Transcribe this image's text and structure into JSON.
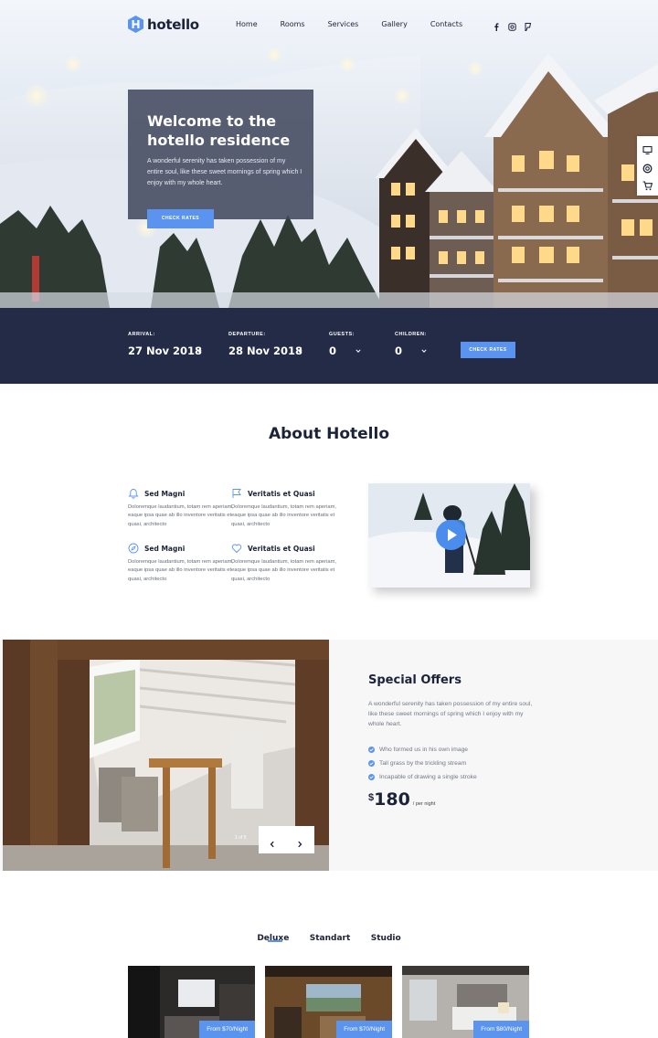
{
  "brand": {
    "name": "hotello",
    "accent": "#5b94ee",
    "dark": "#232b47"
  },
  "nav": {
    "items": [
      {
        "label": "Home"
      },
      {
        "label": "Rooms"
      },
      {
        "label": "Services"
      },
      {
        "label": "Gallery"
      },
      {
        "label": "Contacts"
      }
    ],
    "socials": [
      "facebook-icon",
      "instagram-icon",
      "foursquare-icon"
    ]
  },
  "side_tools": [
    "monitor-icon",
    "lifebuoy-icon",
    "cart-icon"
  ],
  "hero": {
    "title": "Welcome to the hotello residence",
    "text": "A wonderful serenity has taken possession of my entire soul, like these sweet mornings of spring which I enjoy with my whole heart.",
    "button": "CHECK RATES"
  },
  "booking": {
    "arrival": {
      "label": "ARRIVAL:",
      "value": "27 Nov 2018"
    },
    "departure": {
      "label": "DEPARTURE:",
      "value": "28 Nov 2018"
    },
    "guests": {
      "label": "GUESTS:",
      "value": "0"
    },
    "children": {
      "label": "CHILDREN:",
      "value": "0"
    },
    "button": "CHECK RATES"
  },
  "about": {
    "title": "About Hotello",
    "features": [
      {
        "icon": "bell-icon",
        "title": "Sed Magni",
        "text": "Doloremque laudantium, totam rem aperiam, eaque ipsa quae ab illo inventore veritatis et quasi, architecto"
      },
      {
        "icon": "flag-icon",
        "title": "Veritatis et Quasi",
        "text": "Doloremque laudantium, totam rem aperiam, eaque ipsa quae ab illo inventore veritatis et quasi, architecto"
      },
      {
        "icon": "compass-icon",
        "title": "Sed Magni",
        "text": "Doloremque laudantium, totam rem aperiam, eaque ipsa quae ab illo inventore veritatis et quasi, architecto"
      },
      {
        "icon": "heart-icon",
        "title": "Veritatis et Quasi",
        "text": "Doloremque laudantium, totam rem aperiam, eaque ipsa quae ab illo inventore veritatis et quasi, architecto"
      }
    ]
  },
  "offers": {
    "title": "Special Offers",
    "text": "A wonderful serenity has taken possession of my entire soul, like these sweet mornings of spring which I enjoy with my whole heart.",
    "list": [
      "Who formed us in his own image",
      "Tall grass by the trickling stream",
      "Incapable of drawing a single stroke"
    ],
    "currency": "$",
    "price": "180",
    "unit": "/ per night",
    "counter": "1 of 5"
  },
  "rooms": {
    "tabs": [
      "Deluxe",
      "Standart",
      "Studio"
    ],
    "active_tab": "Deluxe",
    "cards": [
      {
        "price": "From $70/Night"
      },
      {
        "price": "From $70/Night"
      },
      {
        "price": "From $80/Night"
      }
    ]
  }
}
